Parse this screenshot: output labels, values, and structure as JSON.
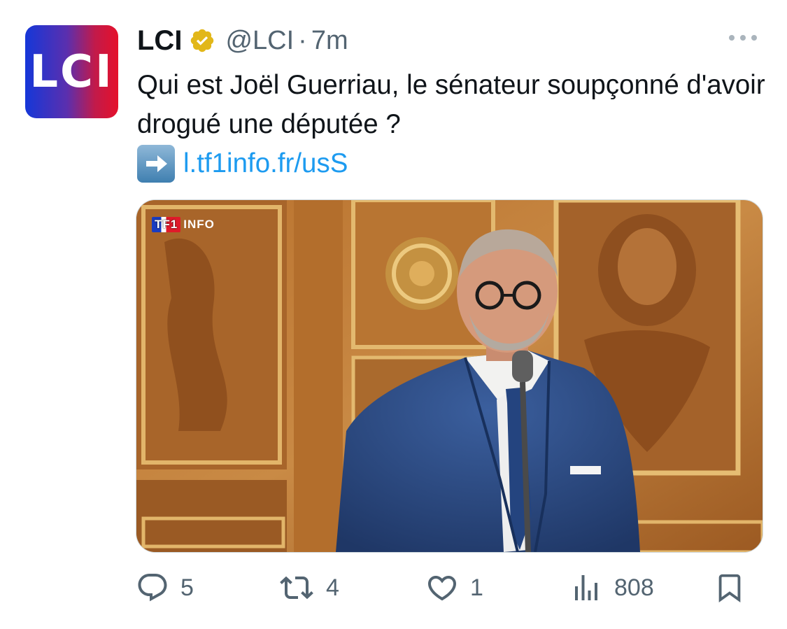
{
  "tweet": {
    "avatar_text": "LCI",
    "display_name": "LCI",
    "handle": "@LCI",
    "separator": "·",
    "time": "7m",
    "text": "Qui est Joël Guerriau, le sénateur soupçonné d'avoir drogué une députée ?",
    "link_emoji_icon": "right-arrow-emoji-icon",
    "link": "l.tf1info.fr/usS",
    "media_watermark": {
      "tf1": "TF1",
      "info": "INFO"
    }
  },
  "actions": {
    "replies": "5",
    "reposts": "4",
    "likes": "1",
    "views": "808"
  },
  "colors": {
    "accent_link": "#1d9bf0",
    "muted": "#536471",
    "verified_gold": "#e2b719"
  }
}
